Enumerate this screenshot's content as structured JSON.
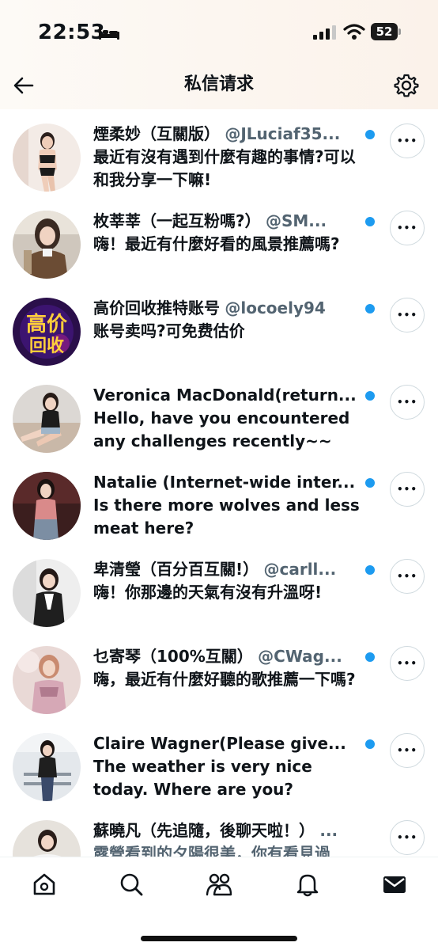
{
  "status_bar": {
    "time": "22:53",
    "battery": "52"
  },
  "header": {
    "title": "私信请求"
  },
  "conversations": [
    {
      "name": "煙柔妙（互關版）",
      "handle": "@JLuciaf35...",
      "message": "最近有沒有遇到什麼有趣的事情?可以和我分享一下嘛!",
      "unread": true
    },
    {
      "name": "枚莘莘（一起互粉嗎?）",
      "handle": "@SM...",
      "message": "嗨！最近有什麼好看的風景推薦嗎?",
      "unread": true
    },
    {
      "name": "高价回收推特账号",
      "handle": "@locoely94",
      "message": "账号卖吗?可免费估价",
      "unread": true
    },
    {
      "name": "Veronica MacDonald(return...",
      "handle": "",
      "message": "Hello, have you encountered any challenges recently~~",
      "unread": true
    },
    {
      "name": "Natalie (Internet-wide inter...",
      "handle": "",
      "message": "Is there more wolves and less meat here?",
      "unread": true
    },
    {
      "name": "卑清瑩（百分百互關!）",
      "handle": "@carll...",
      "message": "嗨！你那邊的天氣有沒有升溫呀!",
      "unread": true
    },
    {
      "name": "乜寄琴（100%互關）",
      "handle": "@CWag...",
      "message": "嗨，最近有什麼好聽的歌推薦一下嗎?",
      "unread": true
    },
    {
      "name": "Claire Wagner(Please give...",
      "handle": "",
      "message": "The weather is very nice today. Where are you?",
      "unread": true
    },
    {
      "name": "蘇曉凡（先追隨，後聊天啦！）",
      "handle": "...",
      "message": "露營看到的夕陽很美，你有看見過",
      "unread": false
    }
  ],
  "more_label": "•••",
  "tab_bar": {
    "tabs": [
      "home-icon",
      "search-icon",
      "communities-icon",
      "notifications-icon",
      "messages-icon"
    ]
  },
  "colors": {
    "accent": "#1d9bf0",
    "text": "#0f1419",
    "secondary": "#536471"
  }
}
